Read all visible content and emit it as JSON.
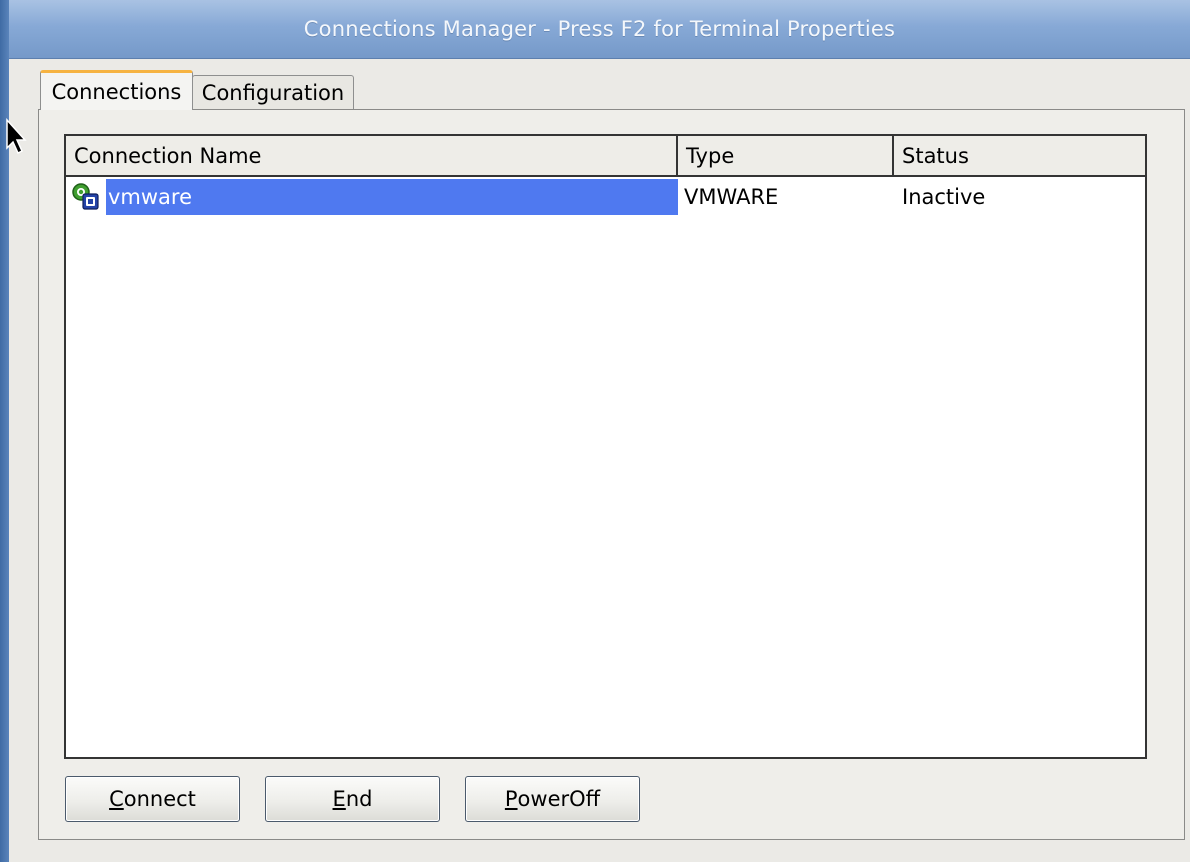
{
  "window": {
    "title": "Connections Manager - Press F2 for Terminal Properties"
  },
  "tabs": [
    {
      "label": "Connections",
      "active": true
    },
    {
      "label": "Configuration",
      "active": false
    }
  ],
  "table": {
    "columns": [
      "Connection Name",
      "Type",
      "Status"
    ],
    "rows": [
      {
        "name": "vmware",
        "type": "VMWARE",
        "status": "Inactive",
        "icon": "vmware-connection-icon",
        "selected": true
      }
    ]
  },
  "buttons": {
    "connect": {
      "mnemonic": "C",
      "rest": "onnect"
    },
    "end": {
      "mnemonic": "E",
      "rest": "nd"
    },
    "poweroff": {
      "mnemonic": "P",
      "rest": "owerOff"
    }
  },
  "colors": {
    "selection": "#4f79f0",
    "tab_active_accent": "#f6b342",
    "titlebar": "#87a9d6"
  }
}
